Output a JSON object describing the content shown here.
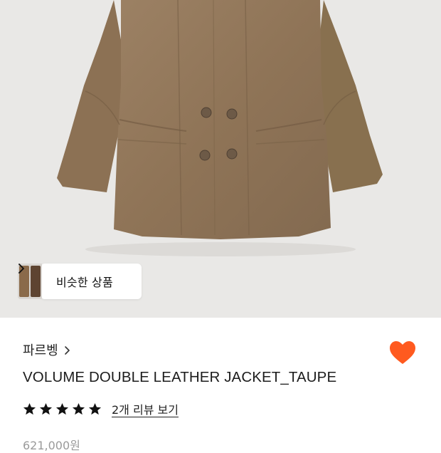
{
  "hero": {
    "similar_button_label": "비슷한 상품"
  },
  "product": {
    "brand": "파르벵",
    "title": "VOLUME DOUBLE LEATHER JACKET_TAUPE",
    "rating_stars": 5,
    "reviews_link": "2개 리뷰 보기",
    "price": "621,000원"
  },
  "colors": {
    "heart": "#ff5a1f",
    "hero_bg": "#e9e8e6",
    "jacket": "#94795c"
  },
  "icons": {
    "wishlist": "heart-icon",
    "rating": "star-icon",
    "chevron": "chevron-right-icon"
  }
}
